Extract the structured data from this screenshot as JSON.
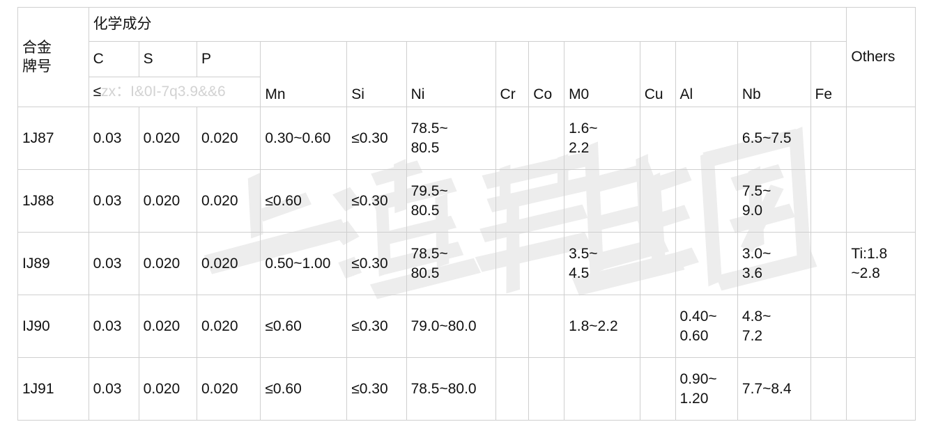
{
  "table": {
    "alloy_header": "合金\n牌号",
    "group_header": "化学成分",
    "others_header": "Others",
    "limit_symbol": "≤",
    "limit_noise": "zx：I&0I-7q3.9&&6",
    "sub_headers": [
      "C",
      "S",
      "P"
    ],
    "element_headers": [
      "Mn",
      "Si",
      "Ni",
      "Cr",
      "Co",
      "M0",
      "Cu",
      "Al",
      "Nb",
      "Fe"
    ],
    "rows": [
      {
        "alloy": "1J87",
        "C": "0.03",
        "S": "0.020",
        "P": "0.020",
        "Mn": "0.30~0.60",
        "Si": "≤0.30",
        "Ni": "78.5~\n80.5",
        "Cr": "",
        "Co": "",
        "Mo": "1.6~\n2.2",
        "Cu": "",
        "Al": "",
        "Nb": "6.5~7.5",
        "Fe": "",
        "Others": ""
      },
      {
        "alloy": "1J88",
        "C": "0.03",
        "S": "0.020",
        "P": "0.020",
        "Mn": "≤0.60",
        "Si": "≤0.30",
        "Ni": "79.5~\n80.5",
        "Cr": "",
        "Co": "",
        "Mo": "",
        "Cu": "",
        "Al": "",
        "Nb": "7.5~\n9.0",
        "Fe": "",
        "Others": ""
      },
      {
        "alloy": "IJ89",
        "C": "0.03",
        "S": "0.020",
        "P": "0.020",
        "Mn": "0.50~1.00",
        "Si": "≤0.30",
        "Ni": "78.5~\n80.5",
        "Cr": "",
        "Co": "",
        "Mo": "3.5~\n4.5",
        "Cu": "",
        "Al": "",
        "Nb": "3.0~\n3.6",
        "Fe": "",
        "Others": "Ti:1.8\n~2.8"
      },
      {
        "alloy": "IJ90",
        "C": "0.03",
        "S": "0.020",
        "P": "0.020",
        "Mn": "≤0.60",
        "Si": "≤0.30",
        "Ni": "79.0~80.0",
        "Cr": "",
        "Co": "",
        "Mo": "1.8~2.2",
        "Cu": "",
        "Al": "0.40~\n0.60",
        "Nb": "4.8~\n7.2",
        "Fe": "",
        "Others": ""
      },
      {
        "alloy": "1J91",
        "C": "0.03",
        "S": "0.020",
        "P": "0.020",
        "Mn": "≤0.60",
        "Si": "≤0.30",
        "Ni": "78.5~80.0",
        "Cr": "",
        "Co": "",
        "Mo": "",
        "Cu": "",
        "Al": "0.90~\n1.20",
        "Nb": "7.7~8.4",
        "Fe": "",
        "Others": ""
      }
    ]
  },
  "watermark": {
    "text": "上海雄钢",
    "color": "#eeeeee"
  },
  "colors": {
    "grid": "#cfcfcf",
    "text": "#111111",
    "faint_text": "#d2d2d2",
    "background": "#ffffff"
  }
}
